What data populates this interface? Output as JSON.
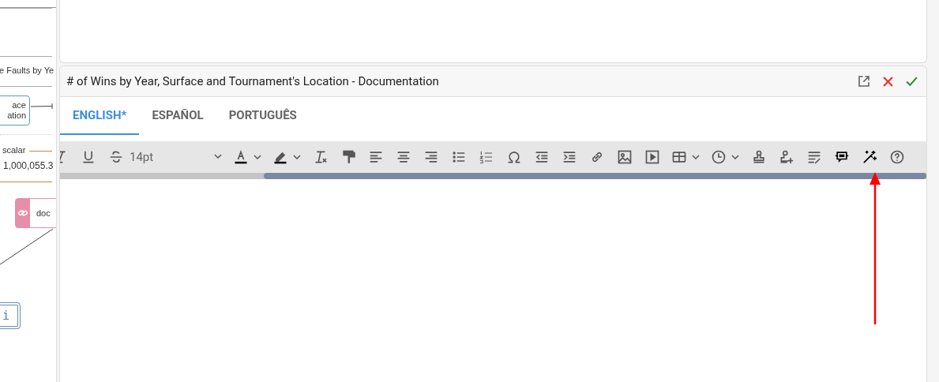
{
  "canvas": {
    "faults_label": "e Faults by Ye",
    "location_node": {
      "lines": [
        "ace",
        "ation"
      ]
    },
    "scalar": {
      "label": "scalar",
      "value": "1,000,055.3"
    },
    "doc_node": {
      "label": "doc"
    },
    "info_button": {
      "label": "i"
    }
  },
  "editor": {
    "title": "# of Wins by Year, Surface and Tournament's Location - Documentation",
    "tabs": [
      {
        "label": "ENGLISH*",
        "selected": true
      },
      {
        "label": "ESPAÑOL",
        "selected": false
      },
      {
        "label": "PORTUGUÊS",
        "selected": false
      }
    ],
    "toolbar": {
      "font_size": "14pt"
    }
  }
}
